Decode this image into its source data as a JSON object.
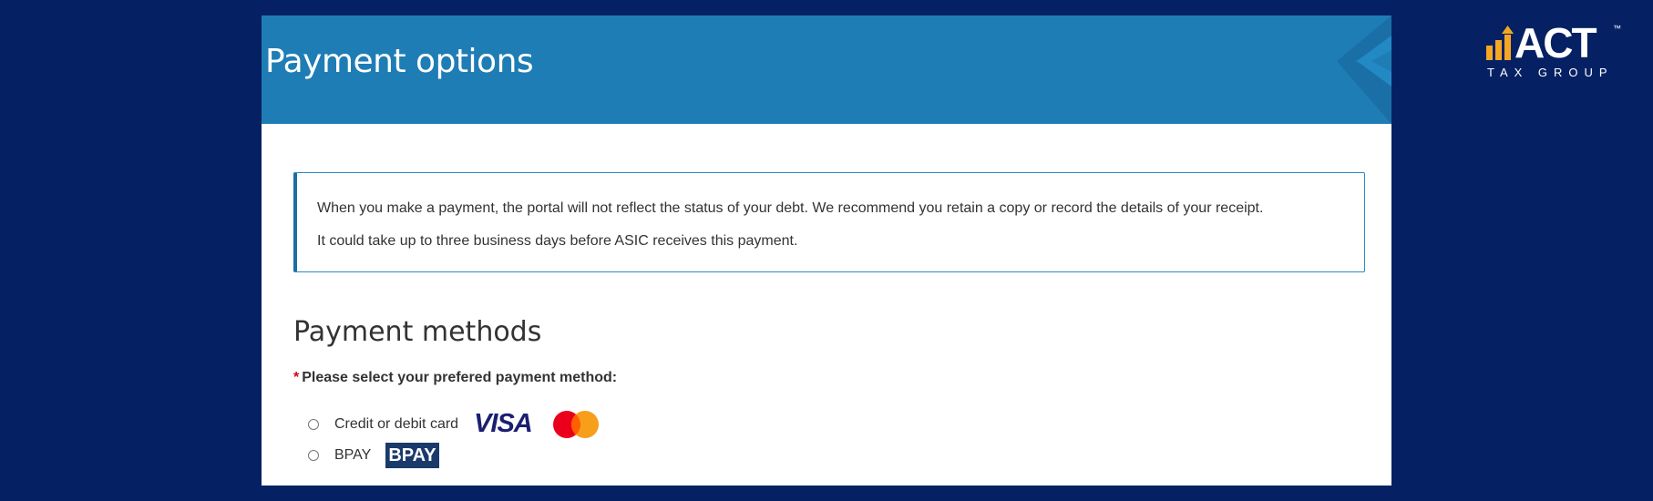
{
  "banner": {
    "title": "Payment options"
  },
  "notice": {
    "line1": "When you make a payment, the portal will not reflect the status of your debt. We recommend you retain a copy or record the details of your receipt.",
    "line2": "It could take up to three business days before ASIC receives this payment."
  },
  "payment_methods": {
    "heading": "Payment methods",
    "required_marker": "*",
    "prompt": "Please select your prefered payment method:",
    "options": [
      {
        "label": "Credit or debit card",
        "selected": false,
        "icons": [
          "visa-logo",
          "mastercard-logo"
        ],
        "visa_text": "VISA"
      },
      {
        "label": "BPAY",
        "selected": false,
        "icons": [
          "bpay-logo"
        ],
        "bpay_text": "BPAY"
      }
    ]
  },
  "brand_logo": {
    "name": "ACT",
    "tm": "™",
    "subtitle": "TAX GROUP"
  },
  "colors": {
    "background": "#062163",
    "banner": "#1f7db5",
    "notice_border": "#2c8cc2",
    "required": "#d0021b",
    "logo_accent": "#f5a623"
  }
}
